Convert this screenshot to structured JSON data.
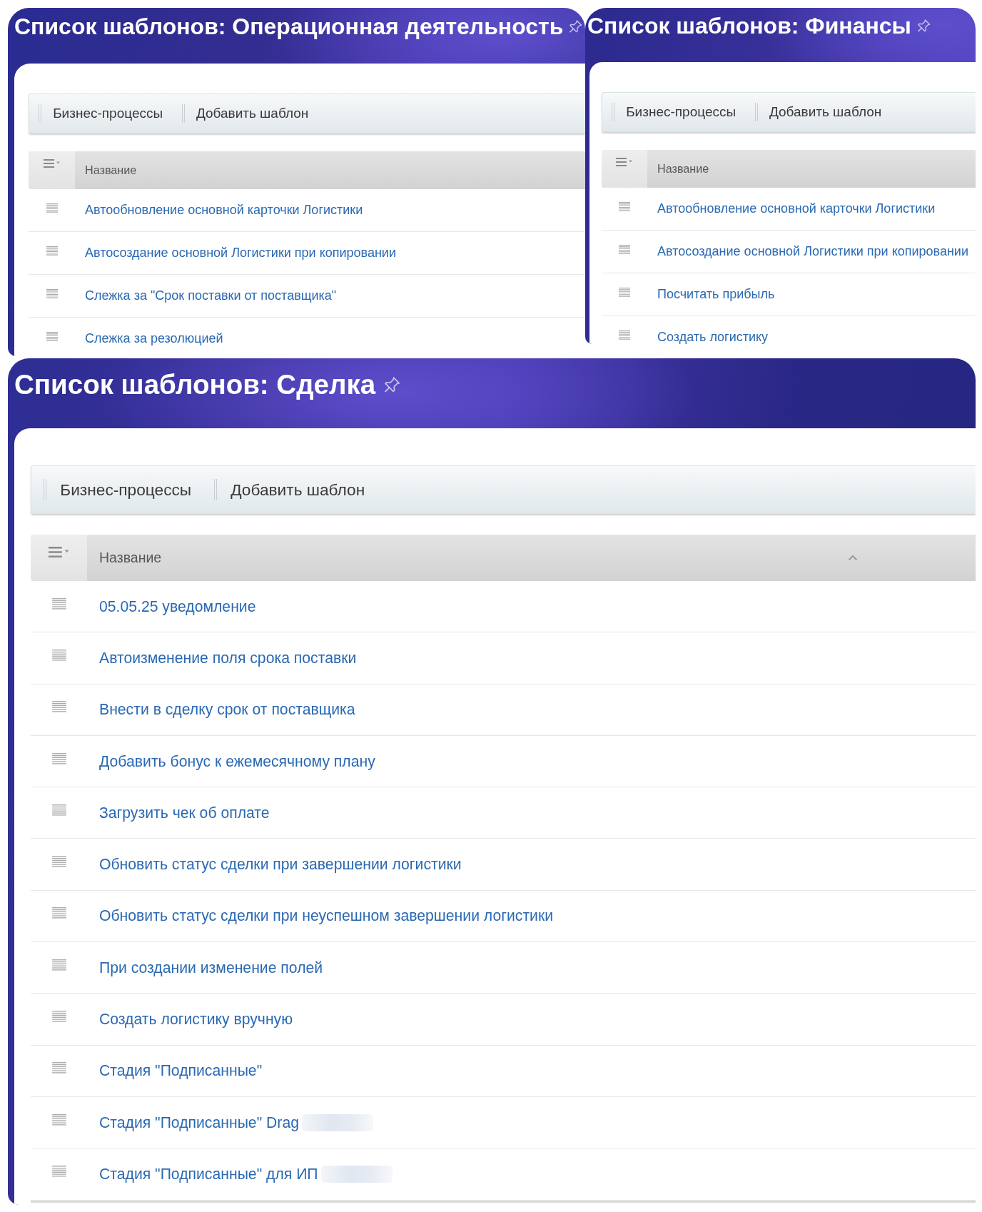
{
  "top_row": [
    {
      "title": "Список шаблонов: Операционная деятельность",
      "toolbar": [
        "Бизнес-процессы",
        "Добавить шаблон"
      ],
      "table": {
        "columns": [
          {
            "label": "Название"
          }
        ],
        "rows": [
          {
            "name": "Автообновление основной карточки Логистики"
          },
          {
            "name": "Автосоздание основной Логистики при копировании"
          },
          {
            "name": "Слежка за \"Срок поставки от поставщика\""
          },
          {
            "name": "Слежка за резолюцией"
          }
        ]
      }
    },
    {
      "title": "Список шаблонов: Финансы",
      "toolbar": [
        "Бизнес-процессы",
        "Добавить шаблон"
      ],
      "table": {
        "columns": [
          {
            "label": "Название"
          }
        ],
        "rows": [
          {
            "name": "Автообновление основной карточки Логистики"
          },
          {
            "name": "Автосоздание основной Логистики при копировании"
          },
          {
            "name": "Посчитать прибыль"
          },
          {
            "name": "Создать логистику"
          }
        ]
      }
    }
  ],
  "bottom_panel": {
    "title": "Список шаблонов: Сделка",
    "toolbar": [
      "Бизнес-процессы",
      "Добавить шаблон"
    ],
    "table": {
      "columns": [
        {
          "label": "Название",
          "sorted": true
        }
      ],
      "rows": [
        {
          "name": "05.05.25 уведомление",
          "redacted": false
        },
        {
          "name": "Автоизменение поля срока поставки",
          "redacted": false
        },
        {
          "name": "Внести в сделку срок от поставщика",
          "redacted": false
        },
        {
          "name": "Добавить бонус к ежемесячному плану",
          "redacted": false
        },
        {
          "name": "Загрузить чек об оплате",
          "redacted": false
        },
        {
          "name": "Обновить статус сделки при завершении логистики",
          "redacted": false
        },
        {
          "name": "Обновить статус сделки при неуспешном завершении логистики",
          "redacted": false
        },
        {
          "name": "При создании изменение полей",
          "redacted": false
        },
        {
          "name": "Создать логистику вручную",
          "redacted": false
        },
        {
          "name": "Стадия \"Подписанные\"",
          "redacted": false
        },
        {
          "name": "Стадия \"Подписанные\" Drag",
          "redacted": true
        },
        {
          "name": "Стадия \"Подписанные\" для ИП",
          "redacted": true
        }
      ]
    }
  }
}
